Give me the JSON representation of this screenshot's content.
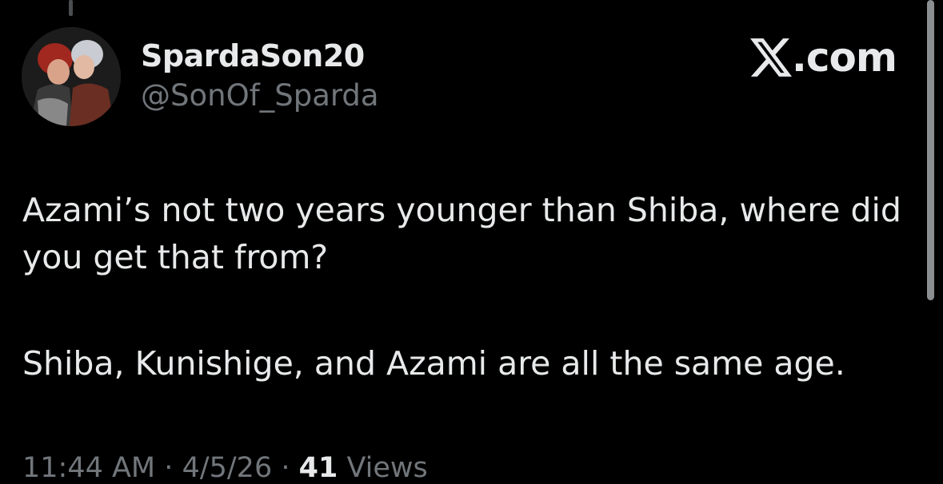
{
  "author": {
    "display_name": "SpardaSon20",
    "handle": "@SonOf_Sparda",
    "avatar_icon": "profile-avatar"
  },
  "brand": {
    "icon": "x-logo-icon",
    "text": ".com"
  },
  "tweet": {
    "paragraphs": [
      "Azami’s not two years younger than Shiba, where did you get that from?",
      "Shiba, Kunishige, and Azami are all the same age."
    ],
    "time": "11:44 AM",
    "separator": "·",
    "date": "4/5/26",
    "views_count": "41",
    "views_label": "Views"
  },
  "colors": {
    "background": "#000000",
    "primary_text": "#e7e9ea",
    "secondary_text": "#71767b"
  }
}
